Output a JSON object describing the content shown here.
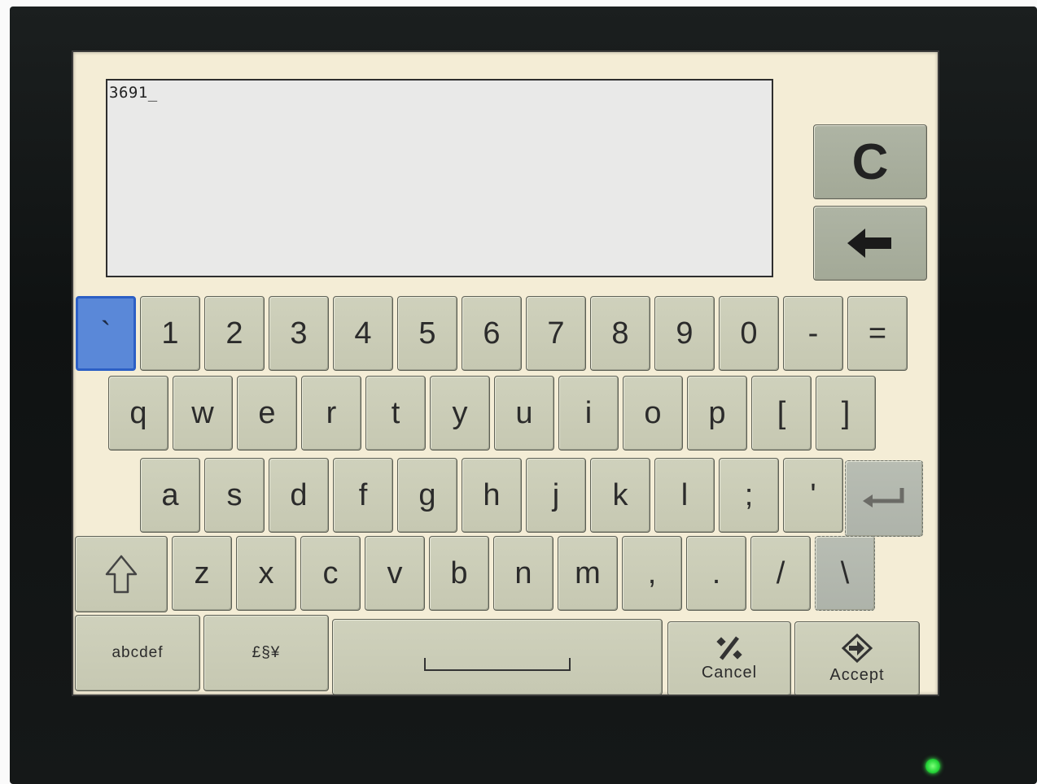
{
  "input": {
    "value": "3691_"
  },
  "controls": {
    "clear_label": "C",
    "backspace_icon": "left-arrow-icon"
  },
  "rows": {
    "numbers": [
      "`",
      "1",
      "2",
      "3",
      "4",
      "5",
      "6",
      "7",
      "8",
      "9",
      "0",
      "-",
      "="
    ],
    "top": [
      "q",
      "w",
      "e",
      "r",
      "t",
      "y",
      "u",
      "i",
      "o",
      "p",
      "[",
      "]"
    ],
    "home": [
      "a",
      "s",
      "d",
      "f",
      "g",
      "h",
      "j",
      "k",
      "l",
      ";",
      "'"
    ],
    "bottom": [
      "z",
      "x",
      "c",
      "v",
      "b",
      "n",
      "m",
      ",",
      ".",
      "/",
      "\\"
    ]
  },
  "modifiers": {
    "shift_icon": "shift-up-arrow-icon",
    "enter_icon": "enter-return-icon",
    "alpha_label": "abcdef",
    "symbols_label": "£§¥",
    "space_icon": "space-bar-icon"
  },
  "actions": {
    "cancel_label": "Cancel",
    "cancel_icon": "percent-cancel-icon",
    "accept_label": "Accept",
    "accept_icon": "diamond-arrow-icon"
  },
  "status": {
    "led_color": "#28d83a"
  }
}
